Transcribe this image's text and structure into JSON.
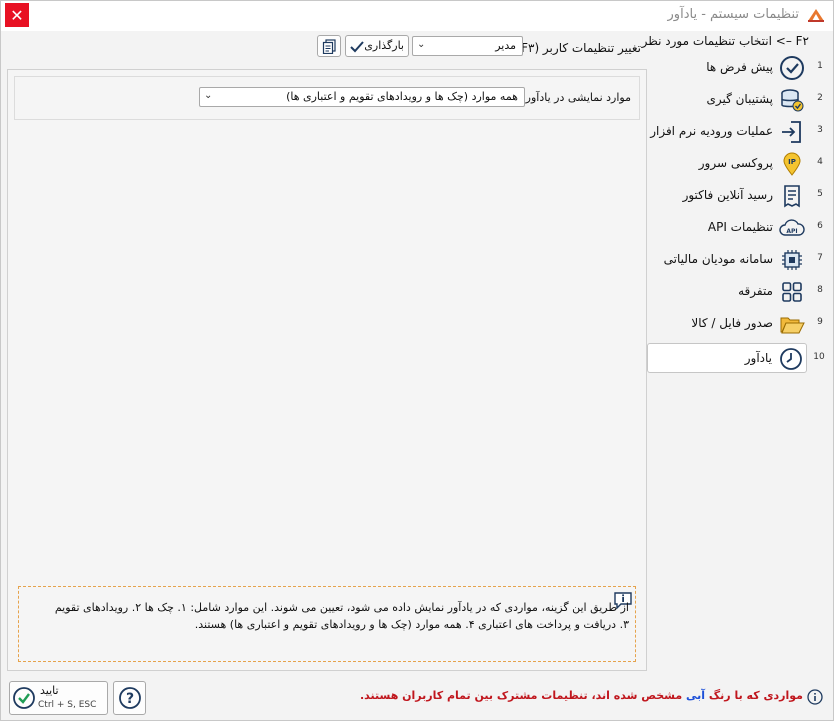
{
  "window": {
    "title": "تنظیمات سیستم - یادآور",
    "close_glyph": "✕"
  },
  "sidebar": {
    "title": "F۲ –> انتخاب تنظیمات مورد نظر",
    "items": [
      {
        "num": "1",
        "label": "پیش فرض ها",
        "icon": "check-circle-icon"
      },
      {
        "num": "2",
        "label": "پشتیبان گیری",
        "icon": "database-backup-icon"
      },
      {
        "num": "3",
        "label": "عملیات ورودیه نرم افزار",
        "icon": "login-enter-icon"
      },
      {
        "num": "4",
        "label": "پروکسی سرور",
        "icon": "ip-pin-icon"
      },
      {
        "num": "5",
        "label": "رسید آنلاین فاکتور",
        "icon": "receipt-icon"
      },
      {
        "num": "6",
        "label": "تنظیمات API",
        "icon": "api-cloud-icon"
      },
      {
        "num": "7",
        "label": "سامانه مودیان مالیاتی",
        "icon": "chip-icon"
      },
      {
        "num": "8",
        "label": "متفرقه",
        "icon": "grid-icon"
      },
      {
        "num": "9",
        "label": "صدور فایل / کالا",
        "icon": "folder-open-icon"
      },
      {
        "num": "10",
        "label": "یادآور",
        "icon": "clock-icon"
      }
    ]
  },
  "toolbar": {
    "user_label": "تغییر تنظیمات کاربر (F۳):",
    "user_value": "مدیر",
    "load_label": "بارگذاری"
  },
  "reminder": {
    "items_label": "موارد نمایشی در یادآور:",
    "items_value": "همه موارد (چک ها و رویدادهای تقویم و اعتباری ها)"
  },
  "info": {
    "text": "از طریق این گزینه، مواردی که در یادآور نمایش داده می شود، تعیین می شوند. این موارد شامل: ۱. چک ها ۲. رویدادهای تقویم ۳. دریافت و پرداخت های اعتباری ۴. همه موارد (چک ها و رویدادهای تقویم و اعتباری ها) هستند."
  },
  "footer": {
    "confirm_label": "تایید",
    "confirm_shortcut": "Ctrl + S, ESC",
    "help_glyph": "?",
    "note_part1": "مواردی که با رنگ",
    "note_blue": "آبی",
    "note_part2": "مشخص شده اند، تنظیمات مشترک بین تمام کاربران هستند."
  },
  "colors": {
    "accent": "#1c6fb8",
    "close": "#e81123",
    "note_red": "#c0161d",
    "note_blue": "#1c4fd8",
    "info_border": "#e6a34c"
  }
}
